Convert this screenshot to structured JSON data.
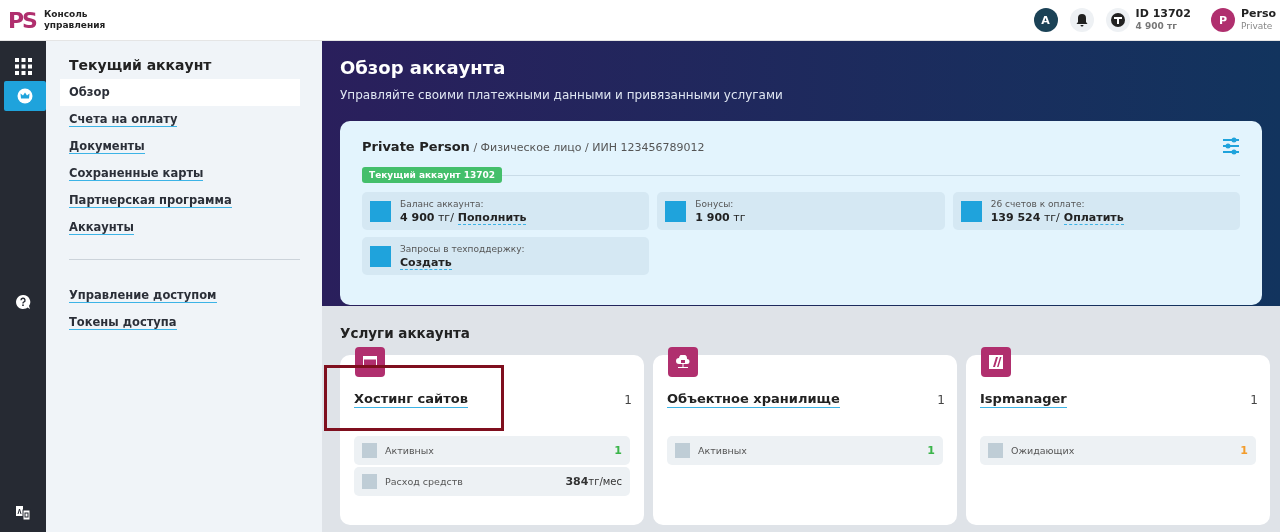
{
  "header": {
    "logo": "PS",
    "product": "Консоль управления",
    "user_initial": "A",
    "account_id": "ID 13702",
    "account_balance": "4 900 тг",
    "profile_initial": "P",
    "profile_name": "Perso",
    "profile_type": "Private"
  },
  "rail": [
    {
      "kind": "apps",
      "selected": false
    },
    {
      "kind": "account",
      "selected": true
    },
    {
      "kind": "help",
      "selected": false
    },
    {
      "kind": "language",
      "selected": false
    }
  ],
  "sidebar": {
    "title": "Текущий аккаунт",
    "groups": [
      [
        {
          "label": "Обзор",
          "selected": true
        },
        {
          "label": "Счета на оплату",
          "selected": false
        },
        {
          "label": "Документы",
          "selected": false
        },
        {
          "label": "Сохраненные карты",
          "selected": false
        },
        {
          "label": "Партнерская программа",
          "selected": false
        },
        {
          "label": "Аккаунты",
          "selected": false
        }
      ],
      [
        {
          "label": "Управление доступом",
          "selected": false
        },
        {
          "label": "Токены доступа",
          "selected": false
        }
      ]
    ]
  },
  "page": {
    "title": "Обзор аккаунта",
    "subtitle": "Управляйте своими платежными данными и привязанными услугами"
  },
  "account": {
    "name": "Private Person",
    "details": "/ Физическое лицо / ИИН 123456789012",
    "badge": "Текущий аккаунт 13702",
    "tiles": [
      {
        "label": "Баланс аккаунта:",
        "value": "4 900",
        "unit": "тг",
        "separator": "/",
        "action": "Пополнить"
      },
      {
        "label": "Бонусы:",
        "value": "1 900",
        "unit": "тг"
      },
      {
        "label": "26 счетов к оплате:",
        "value": "139 524",
        "unit": "тг",
        "separator": "/",
        "action": "Оплатить"
      },
      {
        "label": "Запросы в техподдержку:",
        "action": "Создать"
      }
    ]
  },
  "services": {
    "title": "Услуги аккаунта",
    "items": [
      {
        "kind": "hosting",
        "name": "Хостинг сайтов",
        "count": "1",
        "highlighted": true,
        "stats": [
          {
            "label": "Активных",
            "value": "1",
            "color": "#3bb54a"
          },
          {
            "label": "Расход средств",
            "value": "384",
            "unit": "тг/мес"
          }
        ]
      },
      {
        "kind": "storage",
        "name": "Объектное хранилище",
        "count": "1",
        "highlighted": false,
        "stats": [
          {
            "label": "Активных",
            "value": "1",
            "color": "#3bb54a"
          }
        ]
      },
      {
        "kind": "panel",
        "name": "Ispmanager",
        "count": "1",
        "highlighted": false,
        "stats": [
          {
            "label": "Ожидающих",
            "value": "1",
            "color": "#f39c2b"
          }
        ]
      }
    ]
  }
}
